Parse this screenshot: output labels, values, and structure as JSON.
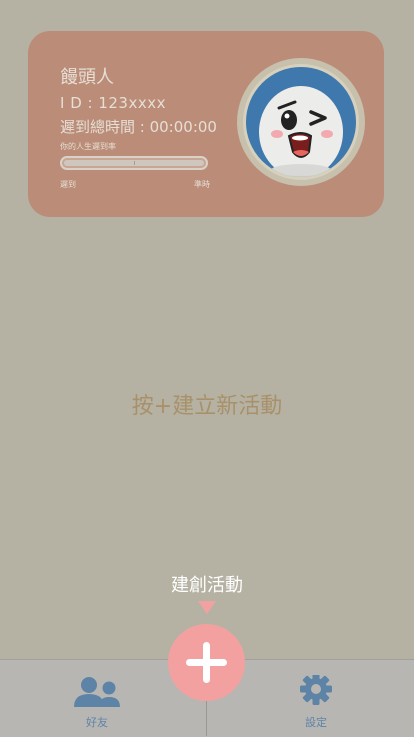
{
  "profile": {
    "name": "饅頭人",
    "id_text": "I D : 123xxxx",
    "late_total": "遲到總時間 : 00:00:00",
    "rate_label": "你的人生遲到率",
    "bar_left_label": "遲到",
    "bar_right_label": "準時",
    "late_rate_marker": 0.5
  },
  "empty_hint": "按+建立新活動",
  "create_button": {
    "tooltip": "建創活動"
  },
  "tabs": {
    "friends_label": "好友",
    "friends_icon": "people-icon",
    "settings_label": "設定",
    "settings_icon": "gear-icon"
  },
  "colors": {
    "background": "#b5b2a3",
    "card": "#bb8c77",
    "accent_pink": "#f2a1a0",
    "tab_blue": "#5d84a7",
    "hint": "#a8916a"
  }
}
